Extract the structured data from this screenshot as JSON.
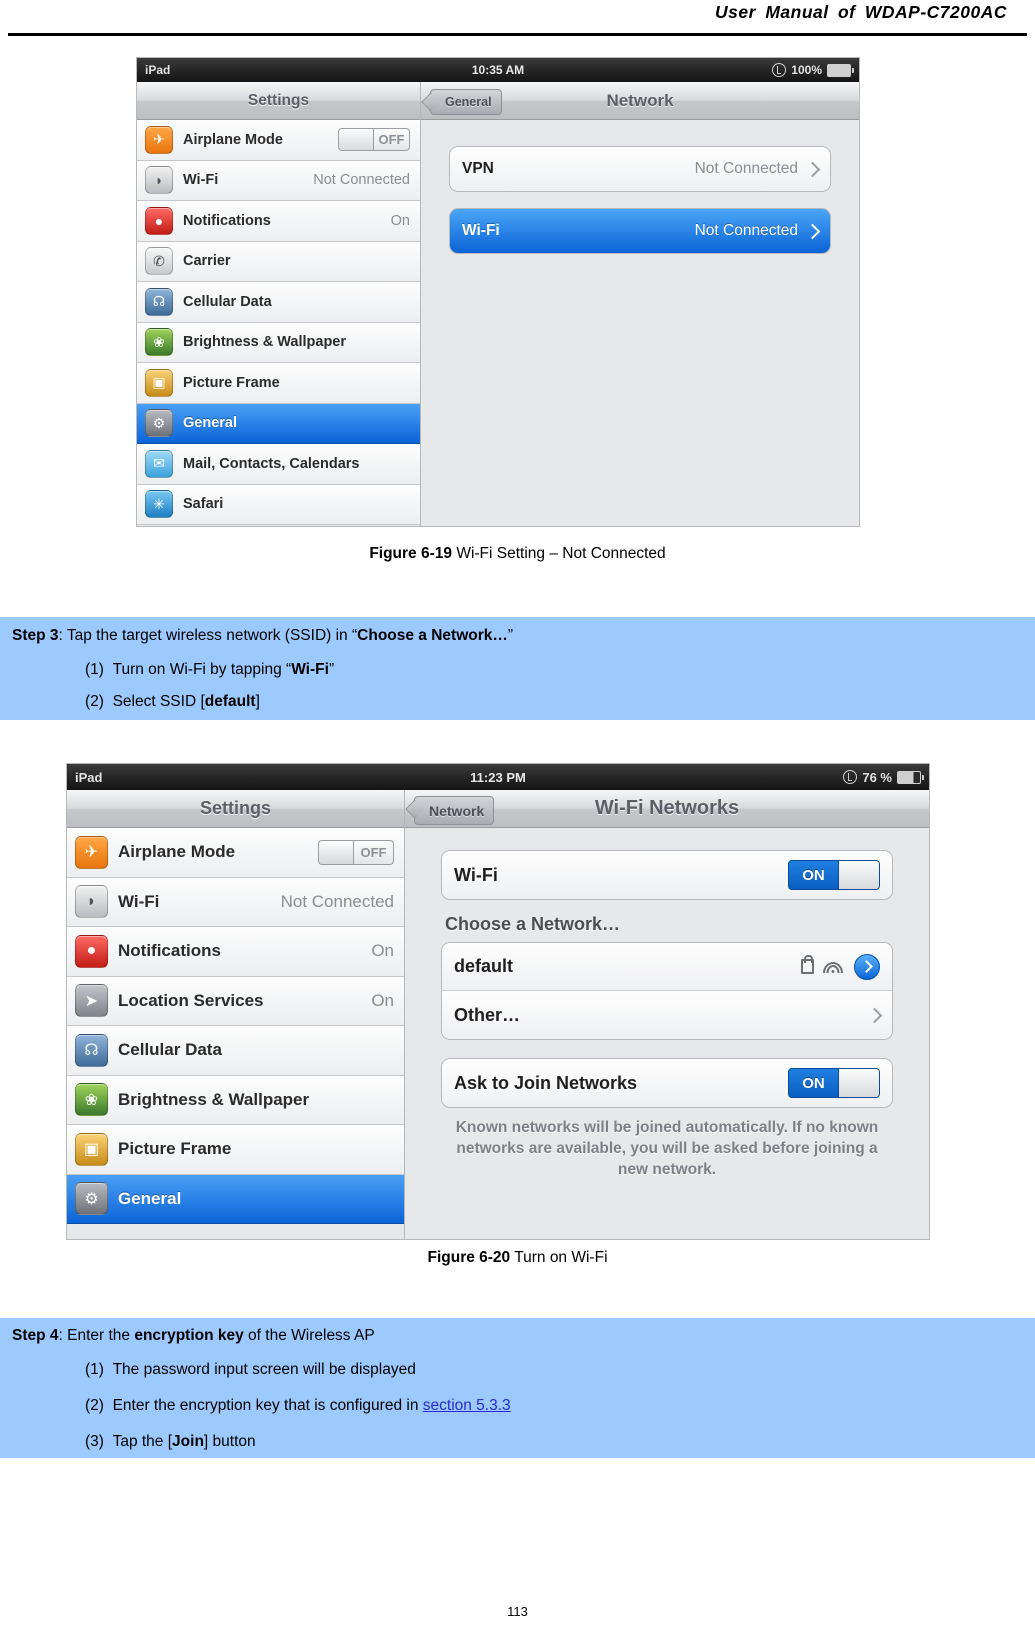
{
  "header": {
    "title": "User  Manual  of  WDAP-C7200AC"
  },
  "figure1": {
    "status": {
      "device": "iPad",
      "time": "10:35 AM",
      "battery_label": "100%"
    },
    "left_pane": {
      "title": "Settings",
      "rows": [
        {
          "label": "Airplane Mode",
          "value": "",
          "toggle": "OFF",
          "icon": "airplane-icon",
          "selected": false
        },
        {
          "label": "Wi-Fi",
          "value": "Not Connected",
          "toggle": "",
          "icon": "wifi-icon",
          "selected": false
        },
        {
          "label": "Notifications",
          "value": "On",
          "toggle": "",
          "icon": "notifications-icon",
          "selected": false
        },
        {
          "label": "Carrier",
          "value": "",
          "toggle": "",
          "icon": "carrier-icon",
          "selected": false
        },
        {
          "label": "Cellular Data",
          "value": "",
          "toggle": "",
          "icon": "cellular-data-icon",
          "selected": false
        },
        {
          "label": "Brightness & Wallpaper",
          "value": "",
          "toggle": "",
          "icon": "brightness-icon",
          "selected": false
        },
        {
          "label": "Picture Frame",
          "value": "",
          "toggle": "",
          "icon": "picture-frame-icon",
          "selected": false
        },
        {
          "label": "General",
          "value": "",
          "toggle": "",
          "icon": "general-gear-icon",
          "selected": true
        },
        {
          "label": "Mail, Contacts, Calendars",
          "value": "",
          "toggle": "",
          "icon": "mail-icon",
          "selected": false
        },
        {
          "label": "Safari",
          "value": "",
          "toggle": "",
          "icon": "safari-icon",
          "selected": false
        }
      ]
    },
    "right_pane": {
      "back_label": "General",
      "title": "Network",
      "rows": [
        {
          "label": "VPN",
          "value": "Not Connected",
          "highlight": false
        },
        {
          "label": "Wi-Fi",
          "value": "Not Connected",
          "highlight": true
        }
      ]
    },
    "caption_bold": "Figure 6-19",
    "caption_rest": " Wi-Fi Setting – Not Connected"
  },
  "step3": {
    "line1_bold": "Step 3",
    "line1_rest": ": Tap the target wireless network (SSID) in “",
    "line1_bold2": "Choose a Network…",
    "line1_tail": "”",
    "items": [
      {
        "num": "(1)",
        "text_pre": "Turn on Wi-Fi by tapping “",
        "text_bold": "Wi-Fi",
        "text_post": "”"
      },
      {
        "num": "(2)",
        "text_pre": "Select SSID [",
        "text_bold": "default",
        "text_post": "]"
      }
    ]
  },
  "figure2": {
    "status": {
      "device": "iPad",
      "time": "11:23 PM",
      "battery_label": "76 %"
    },
    "left_pane": {
      "title": "Settings",
      "rows": [
        {
          "label": "Airplane Mode",
          "value": "",
          "toggle": "OFF",
          "icon": "airplane-icon",
          "selected": false
        },
        {
          "label": "Wi-Fi",
          "value": "Not Connected",
          "toggle": "",
          "icon": "wifi-icon",
          "selected": false
        },
        {
          "label": "Notifications",
          "value": "On",
          "toggle": "",
          "icon": "notifications-icon",
          "selected": false
        },
        {
          "label": "Location Services",
          "value": "On",
          "toggle": "",
          "icon": "location-icon",
          "selected": false
        },
        {
          "label": "Cellular Data",
          "value": "",
          "toggle": "",
          "icon": "cellular-data-icon",
          "selected": false
        },
        {
          "label": "Brightness & Wallpaper",
          "value": "",
          "toggle": "",
          "icon": "brightness-icon",
          "selected": false
        },
        {
          "label": "Picture Frame",
          "value": "",
          "toggle": "",
          "icon": "picture-frame-icon",
          "selected": false
        },
        {
          "label": "General",
          "value": "",
          "toggle": "",
          "icon": "general-gear-icon",
          "selected": true
        }
      ]
    },
    "right_pane": {
      "back_label": "Network",
      "title": "Wi-Fi Networks",
      "wifi_row": {
        "label": "Wi-Fi",
        "toggle": "ON"
      },
      "group_header": "Choose a Network…",
      "networks": [
        {
          "label": "default",
          "secured": true,
          "signal": true,
          "accessory": "blue-chevron"
        },
        {
          "label": "Other…",
          "secured": false,
          "signal": false,
          "accessory": "chevron"
        }
      ],
      "ask_row": {
        "label": "Ask to Join Networks",
        "toggle": "ON"
      },
      "note": "Known networks will be joined automatically.  If no known networks are available, you will be asked before joining a new network."
    },
    "caption_bold": "Figure 6-20",
    "caption_rest": " Turn on Wi-Fi"
  },
  "step4": {
    "line1_bold": "Step 4",
    "line1_rest": ": Enter the ",
    "line1_bold2": "encryption key",
    "line1_tail": " of the Wireless AP",
    "items": [
      {
        "num": "(1)",
        "text_pre": "The password input screen will be displayed",
        "text_bold": "",
        "text_post": ""
      },
      {
        "num": "(2)",
        "text_pre": "Enter the encryption key that is configured in ",
        "link": "section 5.3.3",
        "text_post": ""
      },
      {
        "num": "(3)",
        "text_pre": "Tap the [",
        "text_bold": "Join",
        "text_post": "] button"
      }
    ]
  },
  "footer": {
    "page_number": "113"
  }
}
